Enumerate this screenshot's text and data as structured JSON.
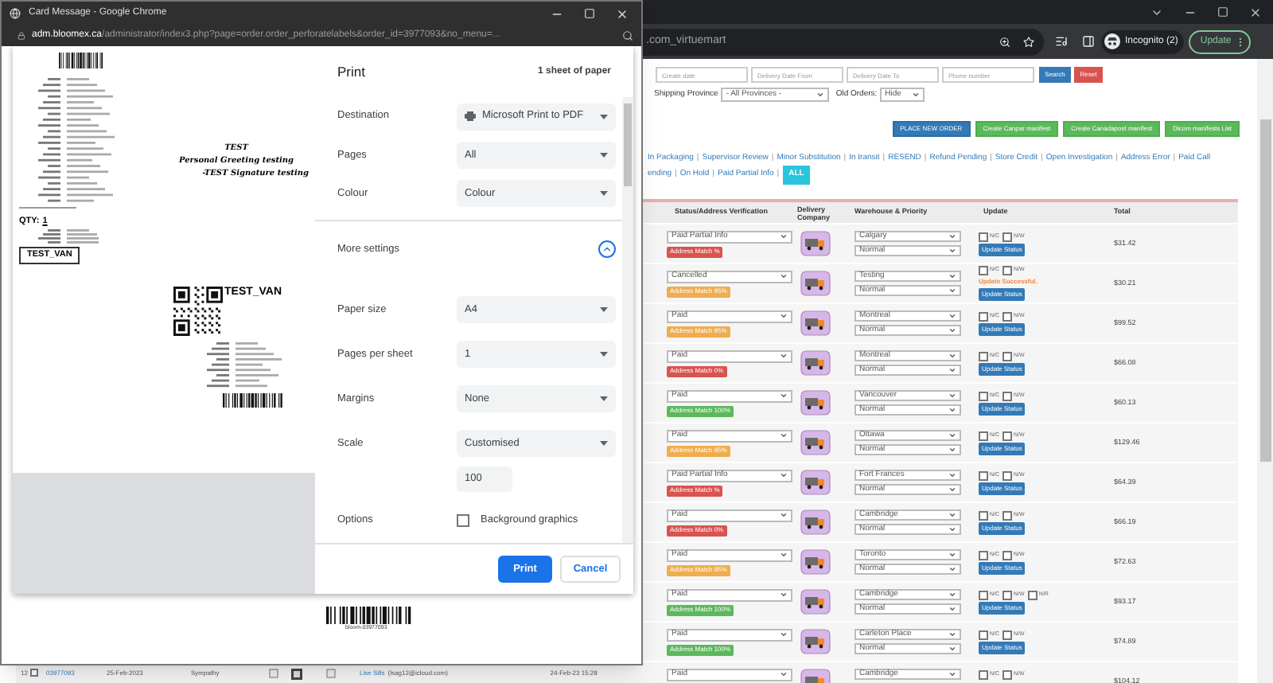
{
  "browser": {
    "address": ".com_virtuemart",
    "profile": "Incognito (2)",
    "update_button": "Update"
  },
  "filters": {
    "fields": [
      {
        "placeholder": "Create date"
      },
      {
        "placeholder": "Delivery Date From"
      },
      {
        "placeholder": "Delivery Date To"
      },
      {
        "placeholder": "Phone number"
      }
    ],
    "search_button": "Search",
    "reset_button": "Reset",
    "province_label": "Shipping Province",
    "province_value": "- All Provinces -",
    "old_orders_label": "Old Orders:",
    "old_orders_value": "Hide"
  },
  "actions": [
    {
      "label": "PLACE NEW ORDER",
      "kind": "primary"
    },
    {
      "label": "Create Canpar manifest",
      "kind": "success"
    },
    {
      "label": "Create Canadapost manifest",
      "kind": "success"
    },
    {
      "label": "Dicom manifests List",
      "kind": "success"
    }
  ],
  "status_links": {
    "separator": "|",
    "lines": [
      [
        {
          "label": "In Packaging",
          "selected": false
        },
        {
          "label": "Supervisor Review",
          "selected": false
        },
        {
          "label": "Minor Substitution",
          "selected": false
        },
        {
          "label": "In transit",
          "selected": false
        },
        {
          "label": "RESEND",
          "selected": false
        },
        {
          "label": "Refund Pending",
          "selected": false
        },
        {
          "label": "Store Credit",
          "selected": false
        },
        {
          "label": "Open Investigation",
          "selected": false
        },
        {
          "label": "Address Error",
          "selected": false
        },
        {
          "label": "Paid Call",
          "selected": false
        }
      ],
      [
        {
          "label": "ending",
          "selected": false
        },
        {
          "label": "On Hold",
          "selected": false
        },
        {
          "label": "Paid Partial Info",
          "selected": false
        },
        {
          "label": "ALL",
          "selected": true
        }
      ]
    ]
  },
  "table": {
    "columns": [
      "Status/Address Verification",
      "Delivery Company",
      "Warehouse & Priority",
      "Update",
      "Total"
    ],
    "rows": [
      {
        "status": "Paid Partial Info",
        "match": "Address Match %",
        "color": "#d9534f",
        "warehouse": "Calgary",
        "priority": "Normal",
        "checks": [
          {
            "label": "N/C",
            "checked": false
          },
          {
            "label": "N/W",
            "checked": false
          }
        ],
        "button": "Update Status",
        "total": "$31.42"
      },
      {
        "status": "Cancelled",
        "match": "Address Match 95%",
        "color": "#f0ad4e",
        "warehouse": "Testing",
        "priority": "Normal",
        "checks": [
          {
            "label": "N/C",
            "checked": false
          },
          {
            "label": "N/W",
            "checked": false
          }
        ],
        "message": "Update Successful.",
        "button": "Update Status",
        "total": "$30.21"
      },
      {
        "status": "Paid",
        "match": "Address Match 95%",
        "color": "#f0ad4e",
        "warehouse": "Montreal",
        "priority": "Normal",
        "checks": [
          {
            "label": "N/C",
            "checked": false
          },
          {
            "label": "N/W",
            "checked": false
          }
        ],
        "button": "Update Status",
        "total": "$99.52"
      },
      {
        "status": "Paid",
        "match": "Address Match 0%",
        "color": "#d9534f",
        "warehouse": "Montreal",
        "priority": "Normal",
        "checks": [
          {
            "label": "N/C",
            "checked": false
          },
          {
            "label": "N/W",
            "checked": false
          }
        ],
        "button": "Update Status",
        "total": "$66.08"
      },
      {
        "status": "Paid",
        "match": "Address Match 100%",
        "color": "#5cb85c",
        "warehouse": "Vancouver",
        "priority": "Normal",
        "checks": [
          {
            "label": "N/C",
            "checked": false
          },
          {
            "label": "N/W",
            "checked": false
          }
        ],
        "button": "Update Status",
        "total": "$60.13"
      },
      {
        "status": "Paid",
        "match": "Address Match 95%",
        "color": "#f0ad4e",
        "warehouse": "Ottawa",
        "priority": "Normal",
        "checks": [
          {
            "label": "N/C",
            "checked": false
          },
          {
            "label": "N/W",
            "checked": false
          }
        ],
        "button": "Update Status",
        "total": "$129.46"
      },
      {
        "status": "Paid Partial Info",
        "match": "Address Match %",
        "color": "#d9534f",
        "warehouse": "Fort Frances",
        "priority": "Normal",
        "checks": [
          {
            "label": "N/C",
            "checked": false
          },
          {
            "label": "N/W",
            "checked": false
          }
        ],
        "button": "Update Status",
        "total": "$64.39"
      },
      {
        "status": "Paid",
        "match": "Address Match 0%",
        "color": "#d9534f",
        "warehouse": "Cambridge",
        "priority": "Normal",
        "checks": [
          {
            "label": "N/C",
            "checked": false
          },
          {
            "label": "N/W",
            "checked": false
          }
        ],
        "button": "Update Status",
        "total": "$66.19"
      },
      {
        "status": "Paid",
        "match": "Address Match 95%",
        "color": "#f0ad4e",
        "warehouse": "Toronto",
        "priority": "Normal",
        "checks": [
          {
            "label": "N/C",
            "checked": false
          },
          {
            "label": "N/W",
            "checked": false
          }
        ],
        "button": "Update Status",
        "total": "$72.63"
      },
      {
        "status": "Paid",
        "match": "Address Match 100%",
        "color": "#5cb85c",
        "warehouse": "Cambridge",
        "priority": "Normal",
        "checks": [
          {
            "label": "N/C",
            "checked": false
          },
          {
            "label": "N/W",
            "checked": false
          },
          {
            "label": "N/R",
            "checked": false
          }
        ],
        "button": "Update Status",
        "total": "$93.17"
      },
      {
        "status": "Paid",
        "match": "Address Match 100%",
        "color": "#5cb85c",
        "warehouse": "Carleton Place",
        "priority": "Normal",
        "checks": [
          {
            "label": "N/C",
            "checked": false
          },
          {
            "label": "N/W",
            "checked": false
          }
        ],
        "button": "Update Status",
        "total": "$74.89"
      },
      {
        "status": "Paid",
        "warehouse": "Cambridge",
        "checks": [
          {
            "label": "N/C",
            "checked": false
          },
          {
            "label": "N/W",
            "checked": false
          }
        ],
        "total": "$104.12",
        "left": {
          "number": "12",
          "checked": false,
          "order": "03977093",
          "date": "25-Feb-2023",
          "occasion": "Sympathy",
          "customer": "Lise Sills",
          "email": "(lsag12@icloud.com)",
          "created": "24-Feb-23 15:28"
        }
      }
    ]
  },
  "popup": {
    "title": "Card Message - Google Chrome",
    "host": "adm.bloomex.ca",
    "path": "/administrator/index3.php?page=order.order_perforatelabels&order_id=3977093&no_menu=...",
    "barcode_caption": "bloom-03977093"
  },
  "preview": {
    "greeting": [
      "TEST",
      "Personal Greeting testing",
      "-TEST Signature testing"
    ],
    "qty_label": "QTY:",
    "qty": "1",
    "van": "TEST_VAN",
    "qr_label": "TEST_VAN"
  },
  "print": {
    "title": "Print",
    "sheets": "1 sheet of paper",
    "settings": [
      {
        "label": "Destination",
        "value": "Microsoft Print to PDF",
        "kind": "printer"
      },
      {
        "label": "Pages",
        "value": "All",
        "kind": "select"
      },
      {
        "label": "Colour",
        "value": "Colour",
        "kind": "select"
      }
    ],
    "more_settings": {
      "label": "More settings",
      "expanded": true
    },
    "advanced": [
      {
        "label": "Paper size",
        "value": "A4"
      },
      {
        "label": "Pages per sheet",
        "value": "1"
      },
      {
        "label": "Margins",
        "value": "None"
      },
      {
        "label": "Scale",
        "value": "Customised",
        "custom_value": "100"
      }
    ],
    "options": {
      "label": "Options",
      "option": "Background graphics",
      "checked": false
    },
    "print_button": "Print",
    "cancel_button": "Cancel"
  }
}
